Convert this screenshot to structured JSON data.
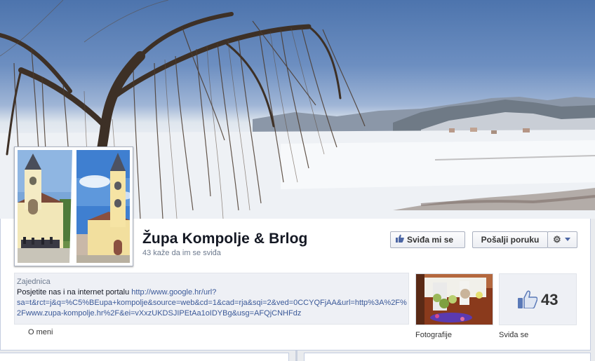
{
  "page": {
    "title": "Župa Kompolje & Brlog",
    "likes_text": "43 kaže da im se sviđa"
  },
  "actions": {
    "like_label": "Sviđa mi se",
    "message_label": "Pošalji poruku",
    "settings_icon": "gear-icon"
  },
  "about": {
    "category": "Zajednica",
    "text_prefix": "Posjetite nas i na internet portalu ",
    "url": "http://www.google.hr/url?sa=t&rct=j&q=%C5%BEupa+kompolje&source=web&cd=1&cad=rja&sqi=2&ved=0CCYQFjAA&url=http%3A%2F%2Fwww.zupa-kompolje.hr%2F&ei=vXxzUKDSJIPEtAa1oIDYBg&usg=AFQjCNHFdz",
    "link_label": "O meni"
  },
  "apps": {
    "photos_label": "Fotografije",
    "likes_label": "Sviđa se",
    "likes_count": "43"
  },
  "colors": {
    "link": "#3b5998",
    "panel_bg": "#eef0f5"
  }
}
